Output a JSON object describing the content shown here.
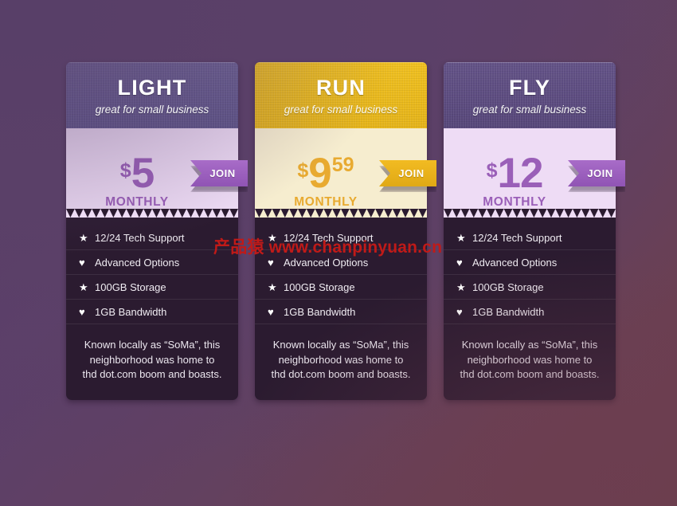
{
  "theme": {
    "background_start": "#57396a",
    "background_end": "#6b3f4f"
  },
  "watermark": {
    "chinese": "产品猿",
    "url": "www.chanpinyuan.cn",
    "color": "#c01a18"
  },
  "plans": [
    {
      "id": "light",
      "name": "LIGHT",
      "tagline": "great for small business",
      "currency": "$",
      "amount": "5",
      "cents": "",
      "period": "MONTHLY",
      "join_label": "JOIN",
      "colors": {
        "header_bg": "#6b6195",
        "header_bg_dark": "#5d5489",
        "price_bg": "#eedcf5",
        "price_text": "#9a5fb8",
        "join_bg": "#a86cc8",
        "join_bg_dark": "#9054b4",
        "body_bg": "#2b1b30"
      },
      "features": [
        {
          "icon": "star-icon",
          "glyph": "★",
          "label": "12/24 Tech Support"
        },
        {
          "icon": "heart-icon",
          "glyph": "♥",
          "label": "Advanced Options"
        },
        {
          "icon": "star-icon",
          "glyph": "★",
          "label": "100GB Storage"
        },
        {
          "icon": "heart-icon",
          "glyph": "♥",
          "label": "1GB Bandwidth"
        }
      ],
      "description": "Known locally as “SoMa”, this neighborhood was home to thd dot.com boom and boasts."
    },
    {
      "id": "run",
      "name": "RUN",
      "tagline": "great for small business",
      "currency": "$",
      "amount": "9",
      "cents": "59",
      "period": "MONTHLY",
      "join_label": "JOIN",
      "colors": {
        "header_bg": "#f0c020",
        "header_bg_dark": "#e5b41a",
        "price_bg": "#f6edcf",
        "price_text": "#e8aa30",
        "join_bg": "#f2bb22",
        "join_bg_dark": "#e0a915",
        "body_bg": "#2b1b30"
      },
      "features": [
        {
          "icon": "star-icon",
          "glyph": "★",
          "label": "12/24 Tech Support"
        },
        {
          "icon": "heart-icon",
          "glyph": "♥",
          "label": "Advanced Options"
        },
        {
          "icon": "star-icon",
          "glyph": "★",
          "label": "100GB Storage"
        },
        {
          "icon": "heart-icon",
          "glyph": "♥",
          "label": "1GB Bandwidth"
        }
      ],
      "description": "Known locally as “SoMa”, this neighborhood was home to thd dot.com boom and boasts."
    },
    {
      "id": "fly",
      "name": "FLY",
      "tagline": "great for small business",
      "currency": "$",
      "amount": "12",
      "cents": "",
      "period": "MONTHLY",
      "join_label": "JOIN",
      "colors": {
        "header_bg": "#635287",
        "header_bg_dark": "#57477a",
        "price_bg": "#eedcf5",
        "price_text": "#9a5fb8",
        "join_bg": "#a86cc8",
        "join_bg_dark": "#9054b4",
        "body_bg": "#2b1b30"
      },
      "features": [
        {
          "icon": "star-icon",
          "glyph": "★",
          "label": "12/24 Tech Support"
        },
        {
          "icon": "heart-icon",
          "glyph": "♥",
          "label": "Advanced Options"
        },
        {
          "icon": "star-icon",
          "glyph": "★",
          "label": "100GB Storage"
        },
        {
          "icon": "heart-icon",
          "glyph": "♥",
          "label": "1GB Bandwidth"
        }
      ],
      "description": "Known locally as “SoMa”, this neighborhood was home to thd dot.com boom and boasts."
    }
  ]
}
